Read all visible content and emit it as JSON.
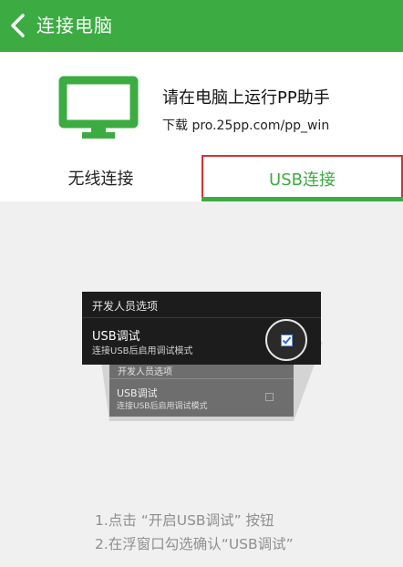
{
  "header": {
    "title": "连接电脑",
    "back_icon": "chevron-left-icon"
  },
  "promo": {
    "title": "请在电脑上运行PP助手",
    "download_text": "下载 pro.25pp.com/pp_win",
    "icon": "monitor-icon"
  },
  "tabs": [
    {
      "label": "无线连接",
      "selected": false
    },
    {
      "label": "USB连接",
      "selected": true
    }
  ],
  "illustration": {
    "front_dialog": {
      "title": "开发人员选项",
      "option_label": "USB调试",
      "option_desc": "连接USB后启用调试模式",
      "checked": true
    },
    "back_dialog": {
      "title": "开发人员选项",
      "option_label": "USB调试",
      "option_desc": "连接USB后启用调试模式",
      "checked": false
    }
  },
  "instructions": [
    "1.点击 “开启USB调试” 按钮",
    "2.在浮窗口勾选确认“USB调试”"
  ],
  "colors": {
    "brand_green": "#3cac42",
    "tab_highlight_border": "#d93030",
    "content_bg": "#f0f0f0",
    "instruction_text": "#8f8f8f"
  }
}
